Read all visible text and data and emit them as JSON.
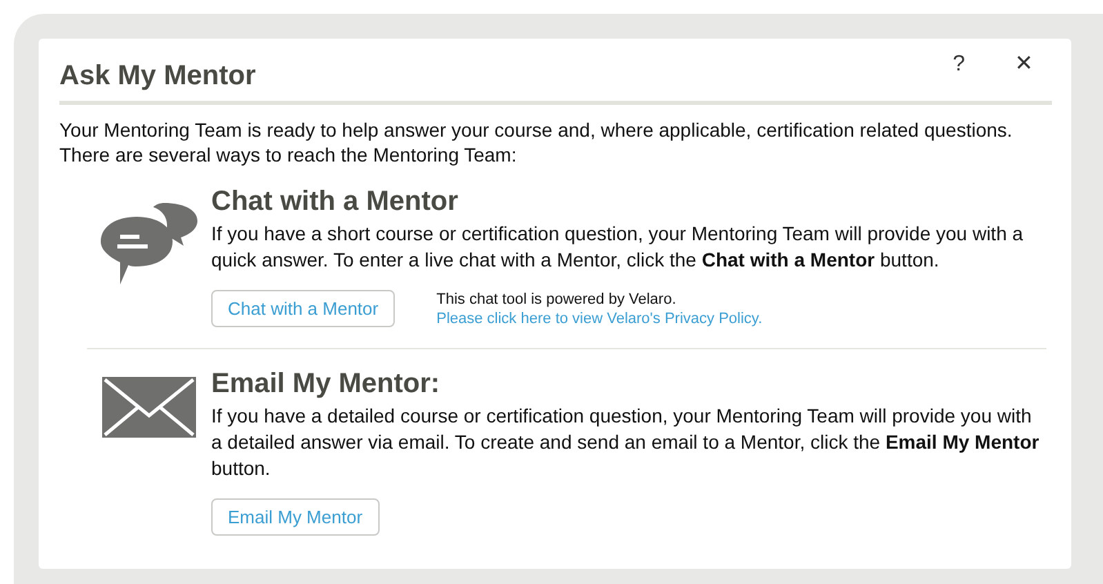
{
  "dialog": {
    "title": "Ask My Mentor",
    "help": "?",
    "close": "✕"
  },
  "intro": [
    "Your Mentoring Team is ready to help answer your course and, where applicable, certification related questions.",
    "There are several ways to reach the Mentoring Team:"
  ],
  "sections": [
    {
      "kind": "chat",
      "heading": "Chat with a Mentor",
      "text": "If you have a short course or certification question, your Mentoring Team will provide you with a quick answer. To enter a live chat with a Mentor, click the **Chat with a Mentor** button.",
      "button": "Chat with a Mentor",
      "note": "This chat tool is powered by Velaro.",
      "link": "Please click here to view Velaro's Privacy Policy."
    },
    {
      "kind": "email",
      "heading": "Email My Mentor:",
      "text": "If you have a detailed course or certification question, your Mentoring Team will provide you with a detailed answer via email. To create and send an email to a Mentor, click the **Email My Mentor** button.",
      "button": "Email My Mentor"
    }
  ]
}
